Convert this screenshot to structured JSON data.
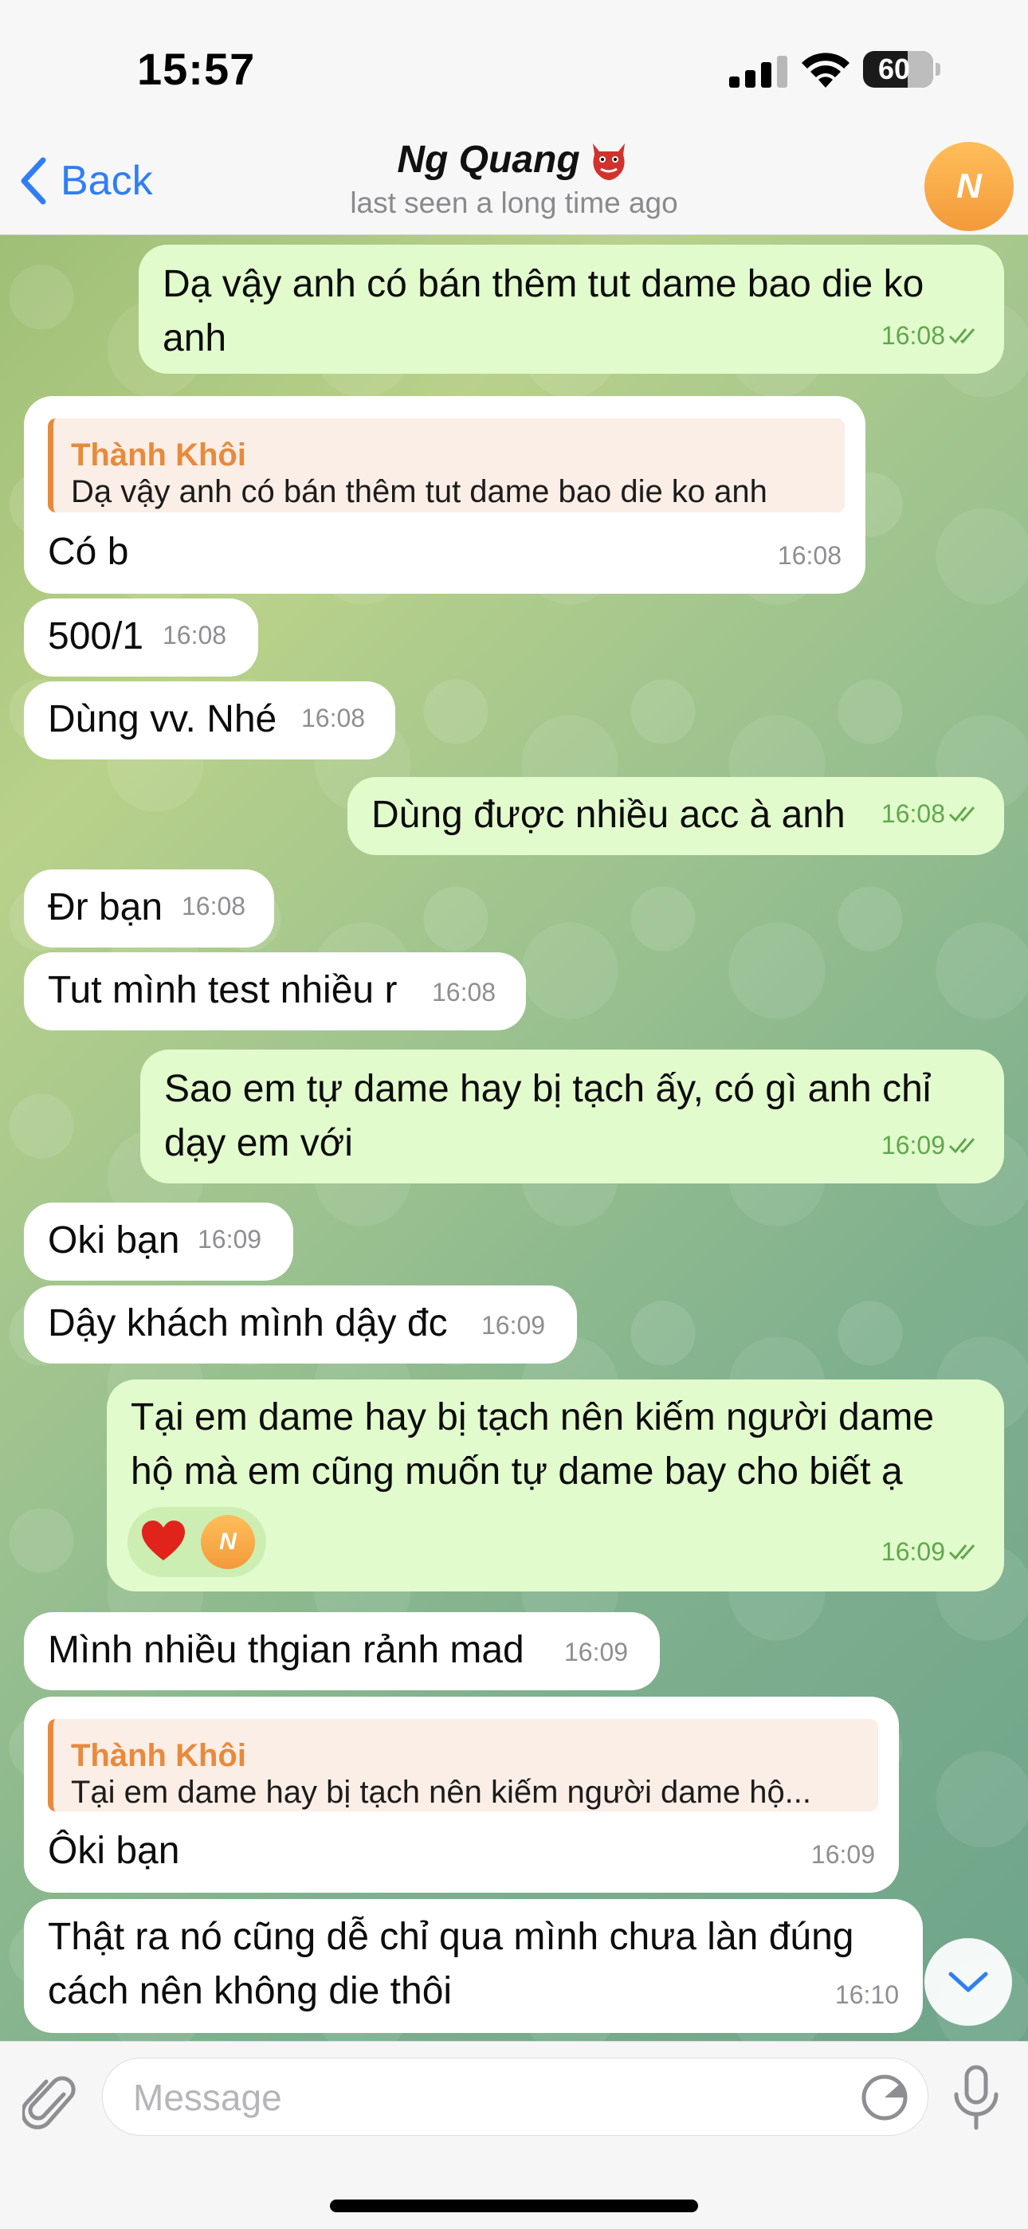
{
  "status_bar": {
    "time": "15:57",
    "battery": "60"
  },
  "header": {
    "back_label": "Back",
    "contact_name": "Ng Quang",
    "last_seen": "last seen a long time ago",
    "avatar_initial": "N"
  },
  "messages": [
    {
      "text": "Dạ vậy anh có bán thêm tut dame bao die ko anh",
      "time": "16:08"
    },
    {
      "reply_name": "Thành Khôi",
      "reply_text": "Dạ vậy anh có bán thêm tut dame bao die ko anh",
      "text": "Có b",
      "time": "16:08"
    },
    {
      "text": "500/1",
      "time": "16:08"
    },
    {
      "text": "Dùng vv. Nhé",
      "time": "16:08"
    },
    {
      "text": "Dùng được nhiều acc à anh",
      "time": "16:08"
    },
    {
      "text": "Đr bạn",
      "time": "16:08"
    },
    {
      "text": "Tut mình test nhiều r",
      "time": "16:08"
    },
    {
      "text": "Sao em tự dame hay bị tạch ấy, có gì anh chỉ dạy em với",
      "time": "16:09"
    },
    {
      "text": "Oki bạn",
      "time": "16:09"
    },
    {
      "text": "Dậy khách mình dậy đc",
      "time": "16:09"
    },
    {
      "text": "Tại em dame hay bị tạch nên kiếm người dame hộ mà em cũng muốn tự dame bay cho biết ạ",
      "time": "16:09",
      "reaction_avatar": "N"
    },
    {
      "text": "Mình nhiều thgian rảnh mad",
      "time": "16:09"
    },
    {
      "reply_name": "Thành Khôi",
      "reply_text": "Tại em dame hay bị tạch nên kiếm người dame hộ...",
      "text": "Ôki bạn",
      "time": "16:09"
    },
    {
      "text": "Thật ra nó cũng dễ chỉ qua mình chưa làn đúng cách nên không die thôi",
      "time": "16:10"
    }
  ],
  "input": {
    "placeholder": "Message"
  },
  "colors": {
    "accent": "#2f7ff0",
    "outgoing_bubble": "#e2fbcc",
    "incoming_bubble": "#ffffff",
    "reply_accent": "#e88a3c",
    "avatar": "#f5a742"
  },
  "icons": [
    "signal-icon",
    "wifi-icon",
    "battery-icon",
    "back-chevron-icon",
    "demon-emoji-icon",
    "double-check-icon",
    "heart-icon",
    "chevron-down-icon",
    "paperclip-icon",
    "sticker-icon",
    "microphone-icon"
  ]
}
